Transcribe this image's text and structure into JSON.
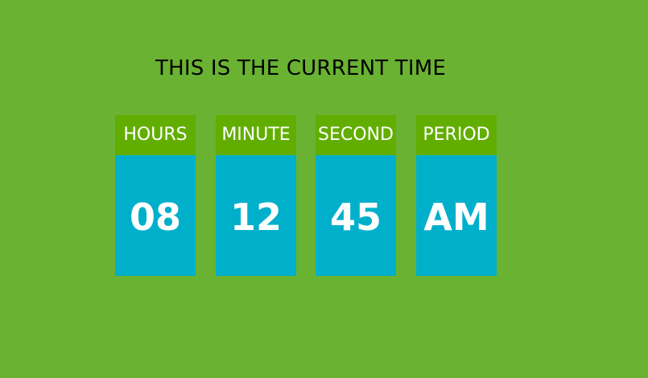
{
  "header": {
    "title": "THIS IS THE CURRENT TIME"
  },
  "clock": {
    "hours": {
      "label": "HOURS",
      "value": "08"
    },
    "minute": {
      "label": "MINUTE",
      "value": "12"
    },
    "second": {
      "label": "SECOND",
      "value": "45"
    },
    "period": {
      "label": "PERIOD",
      "value": "AM"
    }
  },
  "colors": {
    "background": "#6ab232",
    "label_bg": "#62ae00",
    "value_bg": "#00b0cb",
    "text": "#ffffff",
    "title_text": "#000000"
  }
}
